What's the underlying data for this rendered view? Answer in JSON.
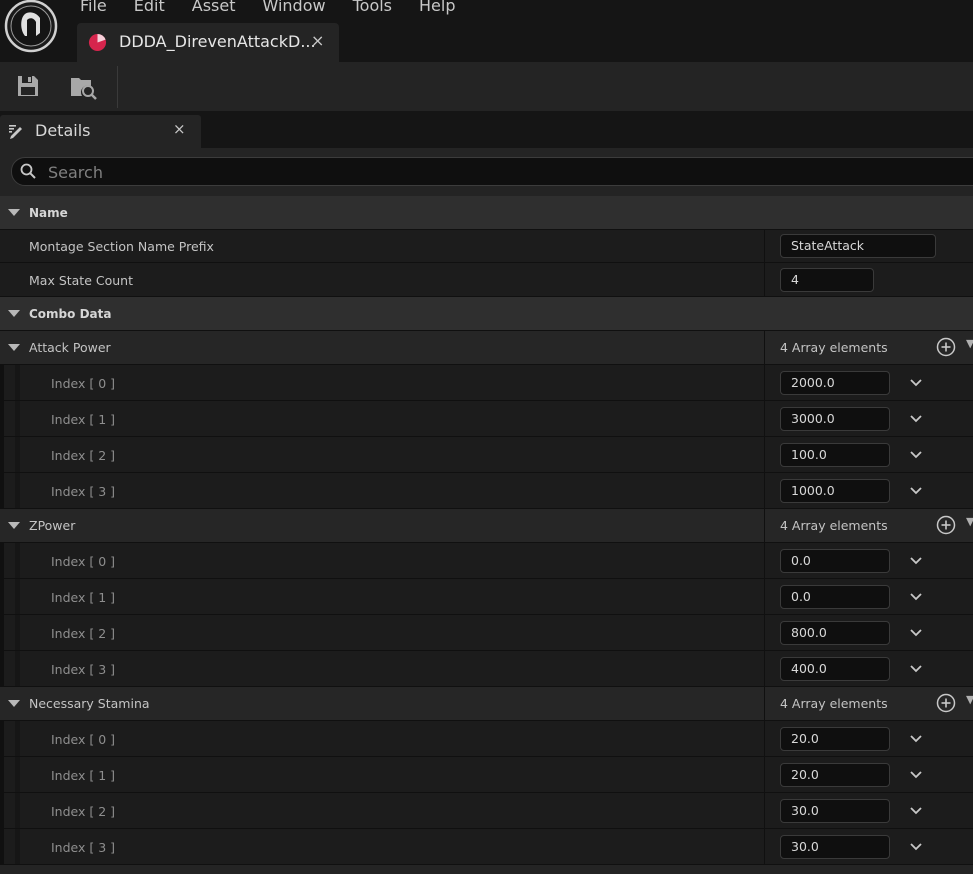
{
  "menu": [
    "File",
    "Edit",
    "Asset",
    "Window",
    "Tools",
    "Help"
  ],
  "document_tab": {
    "title": "DDDA_DirevenAttackD...",
    "close": "×",
    "icon": "data-asset-icon"
  },
  "toolbar": {
    "save_icon": "save-icon",
    "browse_icon": "browse-asset-icon"
  },
  "details_tab": {
    "label": "Details",
    "close": "×",
    "icon": "details-pencil-icon"
  },
  "search": {
    "placeholder": "Search",
    "value": ""
  },
  "colors": {
    "asset_icon": "#d6254d",
    "background": "#242424",
    "value_field": "#0f0f0f"
  },
  "categories": {
    "name": {
      "label": "Name",
      "montage_prefix": {
        "label": "Montage Section Name Prefix",
        "value": "StateAttack"
      },
      "max_state_count": {
        "label": "Max State Count",
        "value": "4"
      }
    },
    "combo": {
      "label": "Combo Data",
      "attack_power": {
        "label": "Attack Power",
        "count": "4 Array elements",
        "items": [
          {
            "label": "Index [ 0 ]",
            "value": "2000.0"
          },
          {
            "label": "Index [ 1 ]",
            "value": "3000.0"
          },
          {
            "label": "Index [ 2 ]",
            "value": "100.0"
          },
          {
            "label": "Index [ 3 ]",
            "value": "1000.0"
          }
        ]
      },
      "zpower": {
        "label": "ZPower",
        "count": "4 Array elements",
        "items": [
          {
            "label": "Index [ 0 ]",
            "value": "0.0"
          },
          {
            "label": "Index [ 1 ]",
            "value": "0.0"
          },
          {
            "label": "Index [ 2 ]",
            "value": "800.0"
          },
          {
            "label": "Index [ 3 ]",
            "value": "400.0"
          }
        ]
      },
      "stamina": {
        "label": "Necessary Stamina",
        "count": "4 Array elements",
        "items": [
          {
            "label": "Index [ 0 ]",
            "value": "20.0"
          },
          {
            "label": "Index [ 1 ]",
            "value": "20.0"
          },
          {
            "label": "Index [ 2 ]",
            "value": "30.0"
          },
          {
            "label": "Index [ 3 ]",
            "value": "30.0"
          }
        ]
      }
    }
  }
}
